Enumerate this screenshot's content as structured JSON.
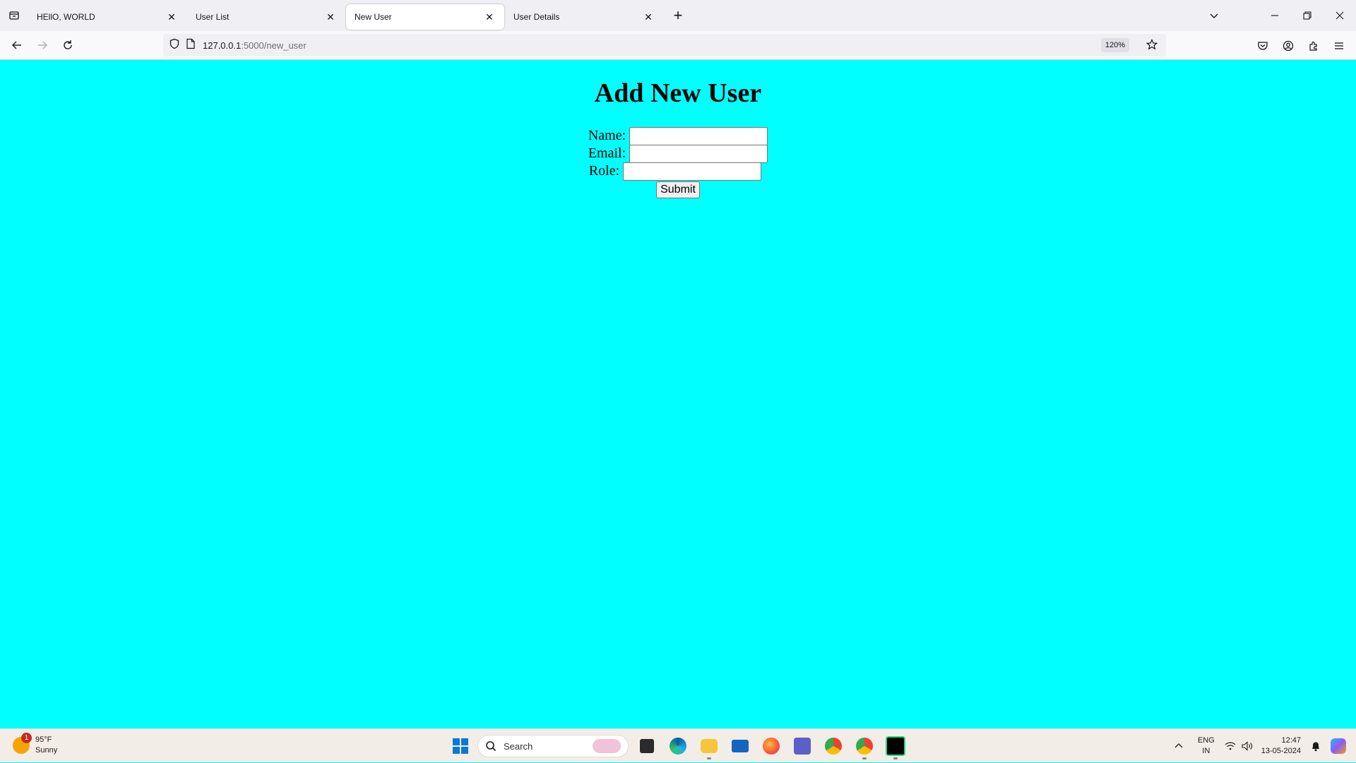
{
  "browser": {
    "tabs": [
      {
        "title": "HEllO, WORLD",
        "active": false
      },
      {
        "title": "User List",
        "active": false
      },
      {
        "title": "New User",
        "active": true
      },
      {
        "title": "User Details",
        "active": false
      }
    ],
    "url_host": "127.0.0.1",
    "url_path": ":5000/new_user",
    "zoom": "120%"
  },
  "page": {
    "heading": "Add New User",
    "background": "#00ffff",
    "fields": [
      {
        "label": "Name:",
        "value": ""
      },
      {
        "label": "Email:",
        "value": ""
      },
      {
        "label": "Role:",
        "value": ""
      }
    ],
    "submit_label": "Submit"
  },
  "taskbar": {
    "weather_temp": "95°F",
    "weather_desc": "Sunny",
    "weather_badge": "1",
    "search_placeholder": "Search",
    "lang_line1": "ENG",
    "lang_line2": "IN",
    "time": "12:47",
    "date": "13-05-2024",
    "apps": [
      "file-explorer-dark-icon",
      "edge-icon",
      "file-explorer-icon",
      "mail-icon",
      "firefox-icon",
      "teams-icon",
      "chrome-icon",
      "chrome-profile-icon",
      "pycharm-icon"
    ]
  },
  "colors": {
    "accent": "#0a78d4",
    "page_bg": "#00ffff"
  }
}
